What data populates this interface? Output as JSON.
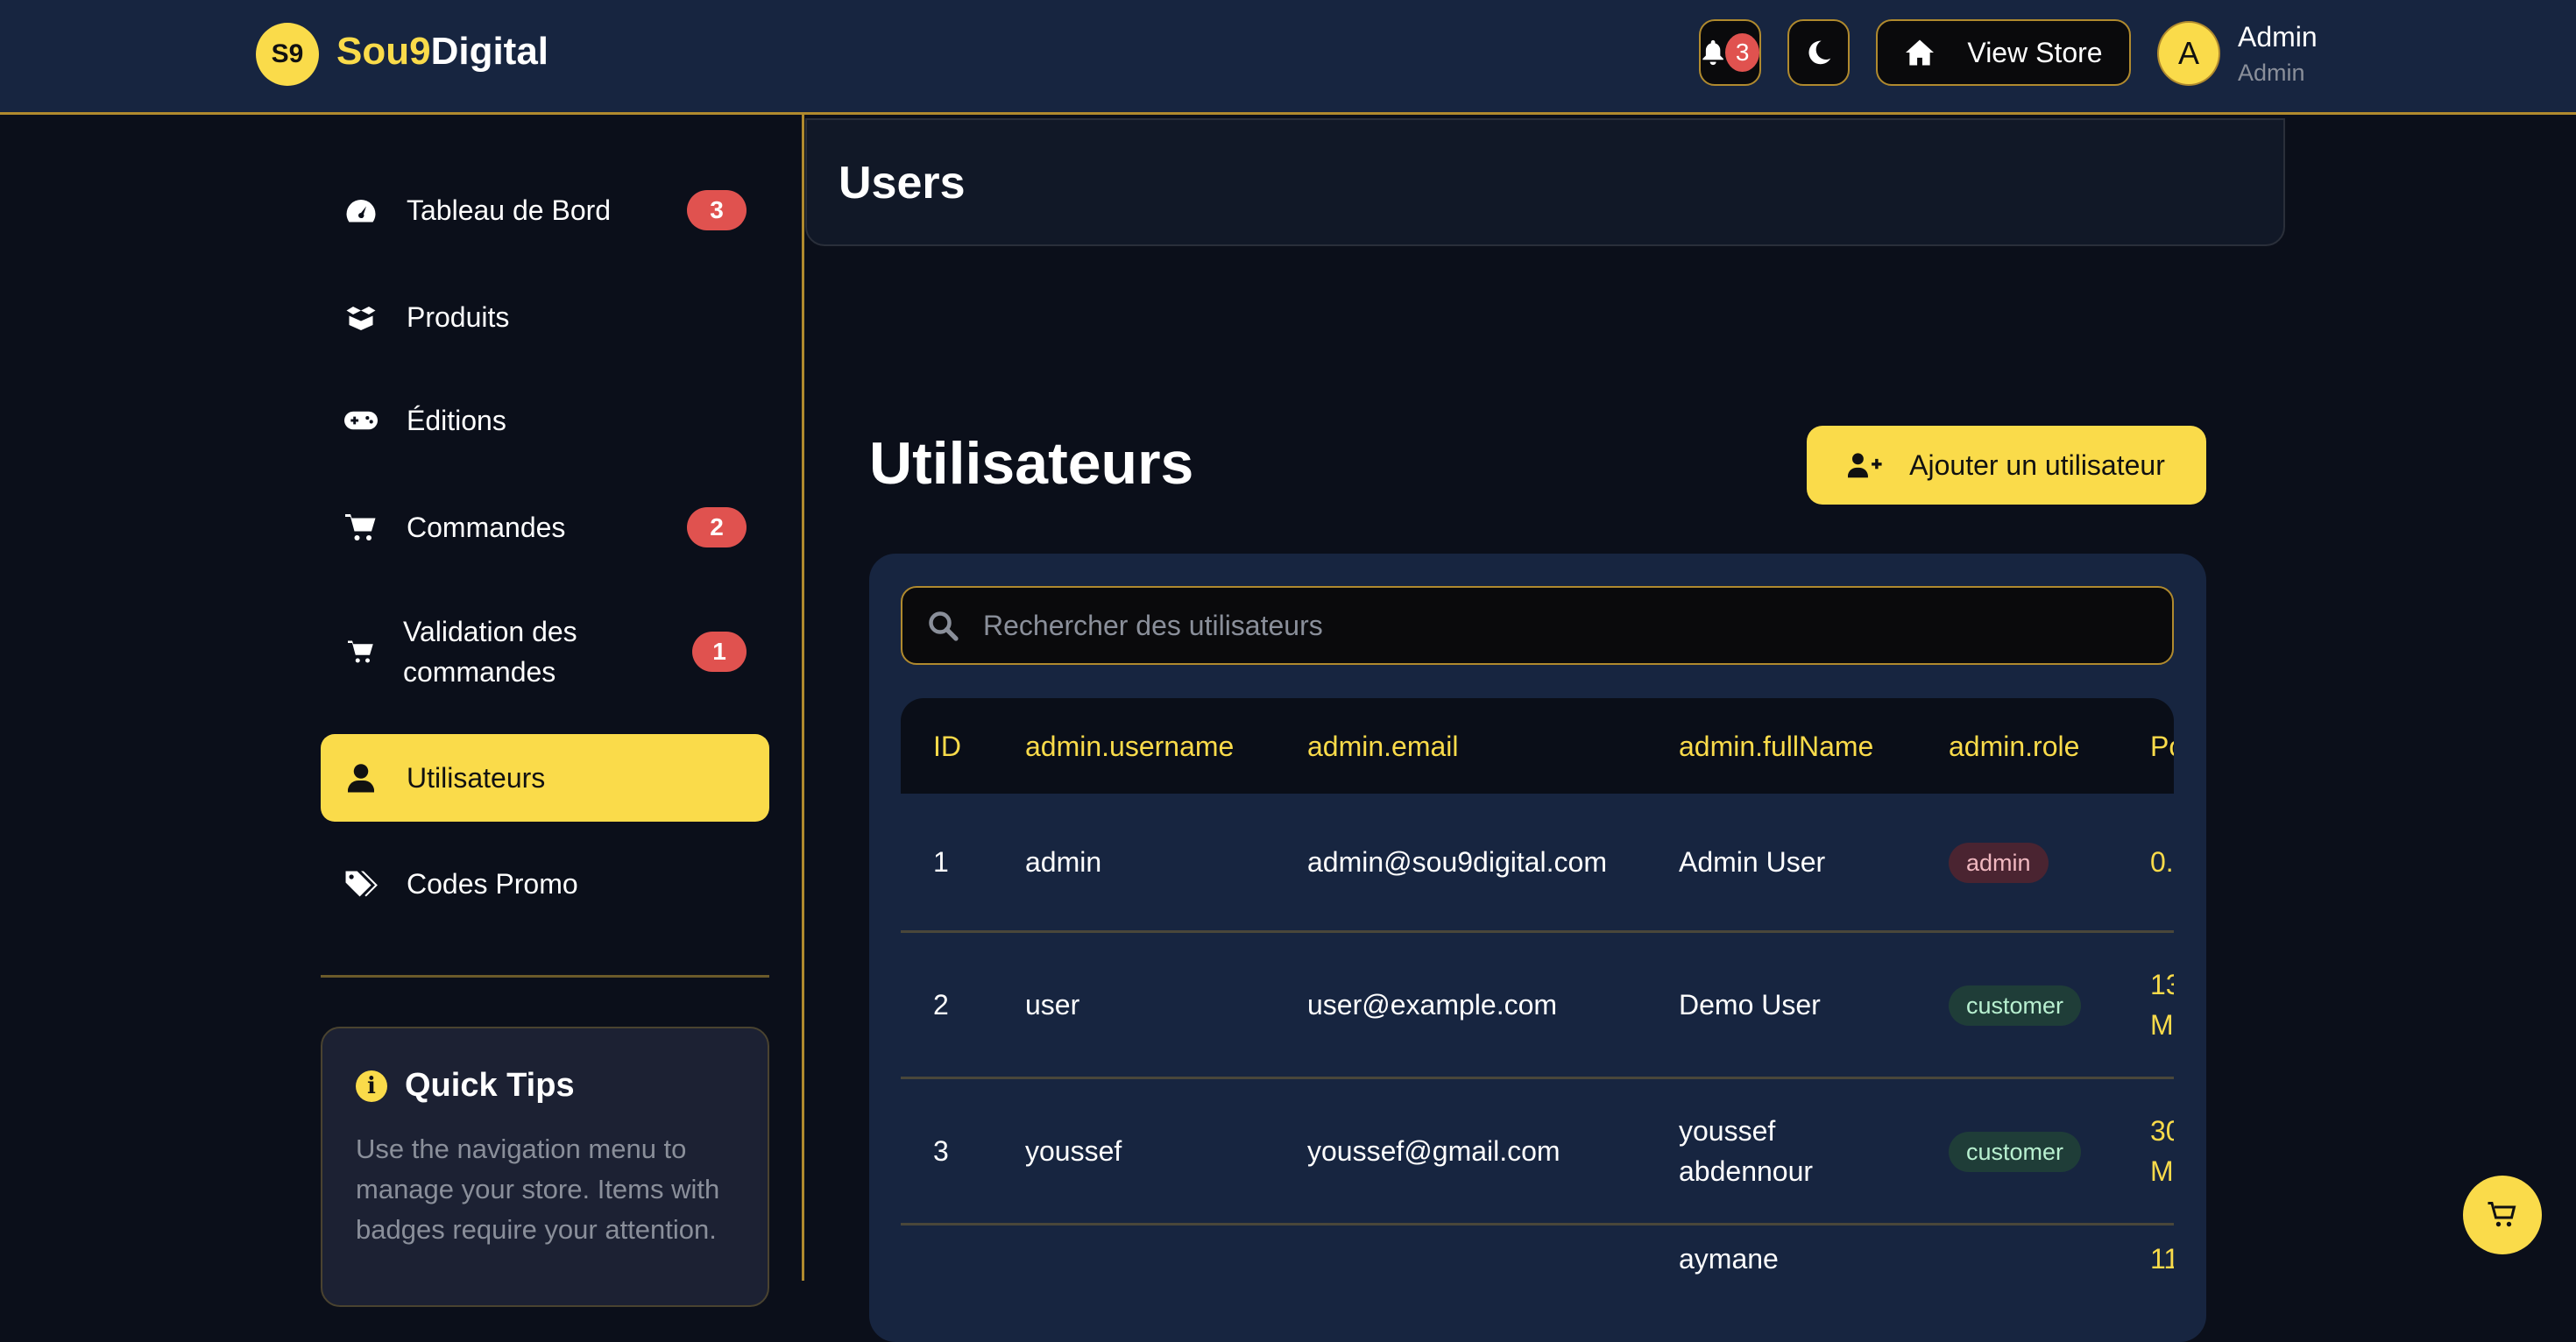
{
  "brand": {
    "logo_initials": "S9",
    "name_part1": "Sou9",
    "name_part2": "Digital"
  },
  "header": {
    "notifications_count": "3",
    "view_store_label": "View Store",
    "avatar_initial": "A",
    "user_name": "Admin",
    "user_role": "Admin"
  },
  "sidebar": {
    "items": [
      {
        "label": "Tableau de Bord",
        "badge": "3",
        "icon": "gauge-icon"
      },
      {
        "label": "Produits",
        "badge": "",
        "icon": "box-open-icon"
      },
      {
        "label": "Éditions",
        "badge": "",
        "icon": "gamepad-icon"
      },
      {
        "label": "Commandes",
        "badge": "2",
        "icon": "cart-icon"
      },
      {
        "label": "Validation des commandes",
        "badge": "1",
        "icon": "cart-check-icon"
      },
      {
        "label": "Utilisateurs",
        "badge": "",
        "icon": "user-icon",
        "active": true
      },
      {
        "label": "Codes Promo",
        "badge": "",
        "icon": "tags-icon"
      }
    ],
    "tips": {
      "title": "Quick Tips",
      "text": "Use the navigation menu to manage your store. Items with badges require your attention."
    }
  },
  "page": {
    "header_title": "Users",
    "title": "Utilisateurs",
    "add_button": "Ajouter un utilisateur",
    "search_placeholder": "Rechercher des utilisateurs"
  },
  "table": {
    "headers": [
      "ID",
      "admin.username",
      "admin.email",
      "admin.fullName",
      "admin.role",
      "Po"
    ],
    "rows": [
      {
        "id": "1",
        "username": "admin",
        "email": "admin@sou9digital.com",
        "fullName": "Admin User",
        "role": "admin",
        "last": "0."
      },
      {
        "id": "2",
        "username": "user",
        "email": "user@example.com",
        "fullName": "Demo User",
        "role": "customer",
        "last": "13 M"
      },
      {
        "id": "3",
        "username": "youssef",
        "email": "youssef@gmail.com",
        "fullName": "youssef abdennour",
        "role": "customer",
        "last": "30 M"
      },
      {
        "id": "",
        "username": "",
        "email": "",
        "fullName": "aymane",
        "role": "",
        "last": "11"
      }
    ]
  },
  "colors": {
    "accent": "#fadb4a",
    "header_bg": "#172540",
    "badge": "#e0524f",
    "page_bg": "#0b0f1a"
  }
}
